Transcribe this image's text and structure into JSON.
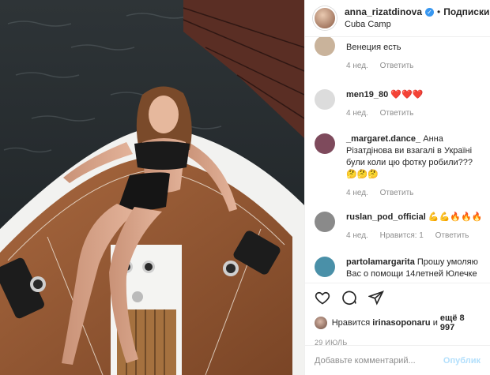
{
  "header": {
    "username": "anna_rizatdinova",
    "separator": "•",
    "follow_label": "Подписки",
    "location": "Cuba Camp",
    "verified_glyph": "✓"
  },
  "comments": [
    {
      "user": "",
      "text": "Венеция есть",
      "time": "4 нед.",
      "reply": "Ответить",
      "likes": "",
      "avatar_color": "#c9b39b"
    },
    {
      "user": "men19_80",
      "text": "❤️❤️❤️",
      "time": "4 нед.",
      "reply": "Ответить",
      "likes": "",
      "avatar_color": "#dcdcdc"
    },
    {
      "user": "_margaret.dance_",
      "text": "Анна Різатдінова ви взагалі в Україні були коли цю фотку робили??? 🤔🤔🤔",
      "time": "4 нед.",
      "reply": "Ответить",
      "likes": "",
      "avatar_color": "#7e4a5c"
    },
    {
      "user": "ruslan_pod_official",
      "text": "💪💪🔥🔥🔥",
      "time": "4 нед.",
      "reply": "Ответить",
      "likes": "Нравится: 1",
      "avatar_color": "#8a8a8a"
    },
    {
      "user": "partolamargarita",
      "text": "Прошу умоляю Вас о помощи 14летней Юлечке",
      "time": "",
      "reply": "",
      "likes": "",
      "avatar_color": "#4a90a8"
    }
  ],
  "actions": {
    "icons": [
      "heart-icon",
      "comment-icon",
      "share-icon",
      "bookmark-icon"
    ],
    "likes_prefix": "Нравится",
    "likes_user": "irinasoponaru",
    "likes_and": "и",
    "likes_more": "ещё 8 997",
    "date": "29 ИЮЛЬ"
  },
  "add_comment": {
    "placeholder": "Добавьте комментарий...",
    "publish_label": "Опубликовать",
    "publish_visible": "Опублик"
  },
  "colors": {
    "accent_blue": "#3897f0",
    "muted": "#8e8e8e",
    "border": "#efefef",
    "heart_red": "#ed4956"
  }
}
